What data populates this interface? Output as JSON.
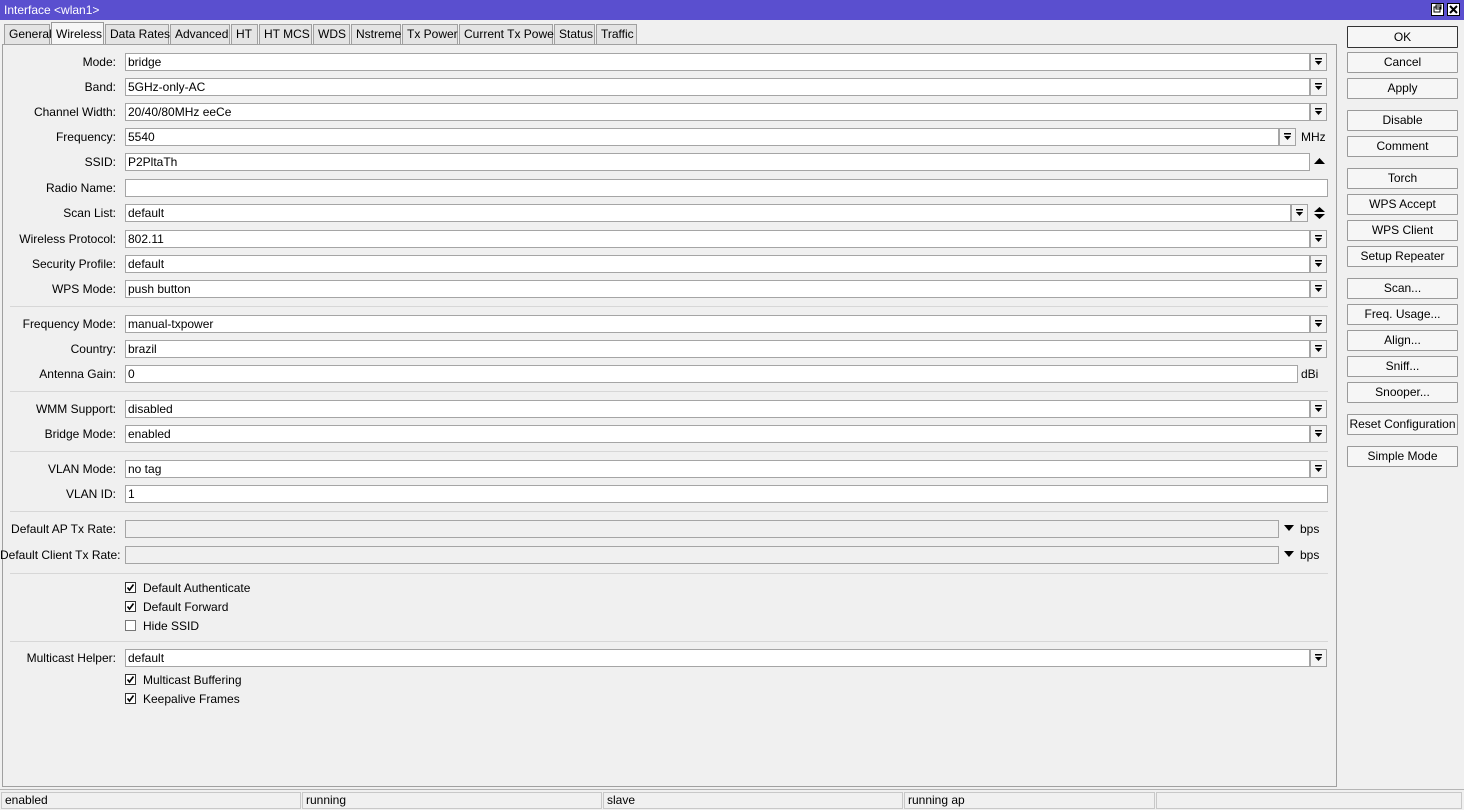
{
  "window": {
    "title": "Interface <wlan1>"
  },
  "tabs": [
    "General",
    "Wireless",
    "Data Rates",
    "Advanced",
    "HT",
    "HT MCS",
    "WDS",
    "Nstreme",
    "Tx Power",
    "Current Tx Power",
    "Status",
    "Traffic"
  ],
  "fields": {
    "mode": {
      "label": "Mode:",
      "value": "bridge"
    },
    "band": {
      "label": "Band:",
      "value": "5GHz-only-AC"
    },
    "channel_width": {
      "label": "Channel Width:",
      "value": "20/40/80MHz eeCe"
    },
    "frequency": {
      "label": "Frequency:",
      "value": "5540",
      "unit": "MHz"
    },
    "ssid": {
      "label": "SSID:",
      "value": "P2PltaTh"
    },
    "radio_name": {
      "label": "Radio Name:",
      "value": ""
    },
    "scan_list": {
      "label": "Scan List:",
      "value": "default"
    },
    "wireless_protocol": {
      "label": "Wireless Protocol:",
      "value": "802.11"
    },
    "security_profile": {
      "label": "Security Profile:",
      "value": "default"
    },
    "wps_mode": {
      "label": "WPS Mode:",
      "value": "push button"
    },
    "frequency_mode": {
      "label": "Frequency Mode:",
      "value": "manual-txpower"
    },
    "country": {
      "label": "Country:",
      "value": "brazil"
    },
    "antenna_gain": {
      "label": "Antenna Gain:",
      "value": "0",
      "unit": "dBi"
    },
    "wmm_support": {
      "label": "WMM Support:",
      "value": "disabled"
    },
    "bridge_mode": {
      "label": "Bridge Mode:",
      "value": "enabled"
    },
    "vlan_mode": {
      "label": "VLAN Mode:",
      "value": "no tag"
    },
    "vlan_id": {
      "label": "VLAN ID:",
      "value": "1"
    },
    "default_ap_tx_rate": {
      "label": "Default AP Tx Rate:",
      "value": "",
      "unit": "bps"
    },
    "default_client_tx_rate": {
      "label": "Default Client Tx Rate:",
      "value": "",
      "unit": "bps"
    },
    "multicast_helper": {
      "label": "Multicast Helper:",
      "value": "default"
    }
  },
  "checkboxes": {
    "default_authenticate": {
      "label": "Default Authenticate",
      "checked": true
    },
    "default_forward": {
      "label": "Default Forward",
      "checked": true
    },
    "hide_ssid": {
      "label": "Hide SSID",
      "checked": false
    },
    "multicast_buffering": {
      "label": "Multicast Buffering",
      "checked": true
    },
    "keepalive_frames": {
      "label": "Keepalive Frames",
      "checked": true
    }
  },
  "buttons": {
    "ok": "OK",
    "cancel": "Cancel",
    "apply": "Apply",
    "disable": "Disable",
    "comment": "Comment",
    "torch": "Torch",
    "wps_accept": "WPS Accept",
    "wps_client": "WPS Client",
    "setup_repeater": "Setup Repeater",
    "scan": "Scan...",
    "freq_usage": "Freq. Usage...",
    "align": "Align...",
    "sniff": "Sniff...",
    "snooper": "Snooper...",
    "reset_configuration": "Reset Configuration",
    "simple_mode": "Simple Mode"
  },
  "status": [
    "enabled",
    "running",
    "slave",
    "running ap",
    ""
  ]
}
